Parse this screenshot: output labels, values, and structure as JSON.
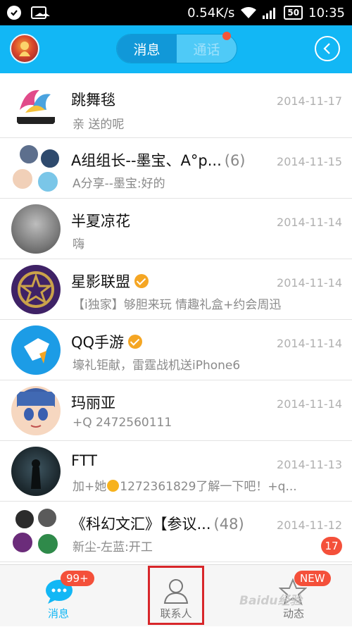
{
  "status_bar": {
    "network_speed": "0.54K/s",
    "battery": "50",
    "time": "10:35"
  },
  "header": {
    "tabs": [
      {
        "label": "消息",
        "active": true
      },
      {
        "label": "通话",
        "active": false,
        "has_dot": true
      }
    ]
  },
  "conversations": [
    {
      "name": "跳舞毯",
      "date": "2014-11-17",
      "preview": "亲 送的呢"
    },
    {
      "name": "A组组长--墨宝、A°p...",
      "count": "(6)",
      "date": "2014-11-15",
      "preview": "A分享--墨宝:好的"
    },
    {
      "name": "半夏凉花",
      "date": "2014-11-14",
      "preview": "嗨"
    },
    {
      "name": "星影联盟",
      "verified": true,
      "date": "2014-11-14",
      "preview": "【i独家】够胆来玩 情趣礼盒+约会周迅"
    },
    {
      "name": "QQ手游",
      "verified": true,
      "date": "2014-11-14",
      "preview": "壕礼钜献，雷霆战机送iPhone6"
    },
    {
      "name": "玛丽亚",
      "date": "2014-11-14",
      "preview": "+Q 2472560111"
    },
    {
      "name": "FTT",
      "date": "2014-11-13",
      "preview_before": "加+她",
      "preview_after": "1272361829了解一下吧！+q..."
    },
    {
      "name": "《科幻文汇》【参议...",
      "count": "(48)",
      "date": "2014-11-12",
      "preview": "新尘-左蓝:开工",
      "unread": "17"
    }
  ],
  "tabbar": {
    "messages": {
      "label": "消息",
      "badge": "99+"
    },
    "contacts": {
      "label": "联系人"
    },
    "moments": {
      "label": "动态",
      "badge": "NEW"
    }
  },
  "watermark": "Baidu经验",
  "colors": {
    "accent": "#12b7f5",
    "badge_red": "#f4503a",
    "highlight_red": "#d8262a"
  }
}
